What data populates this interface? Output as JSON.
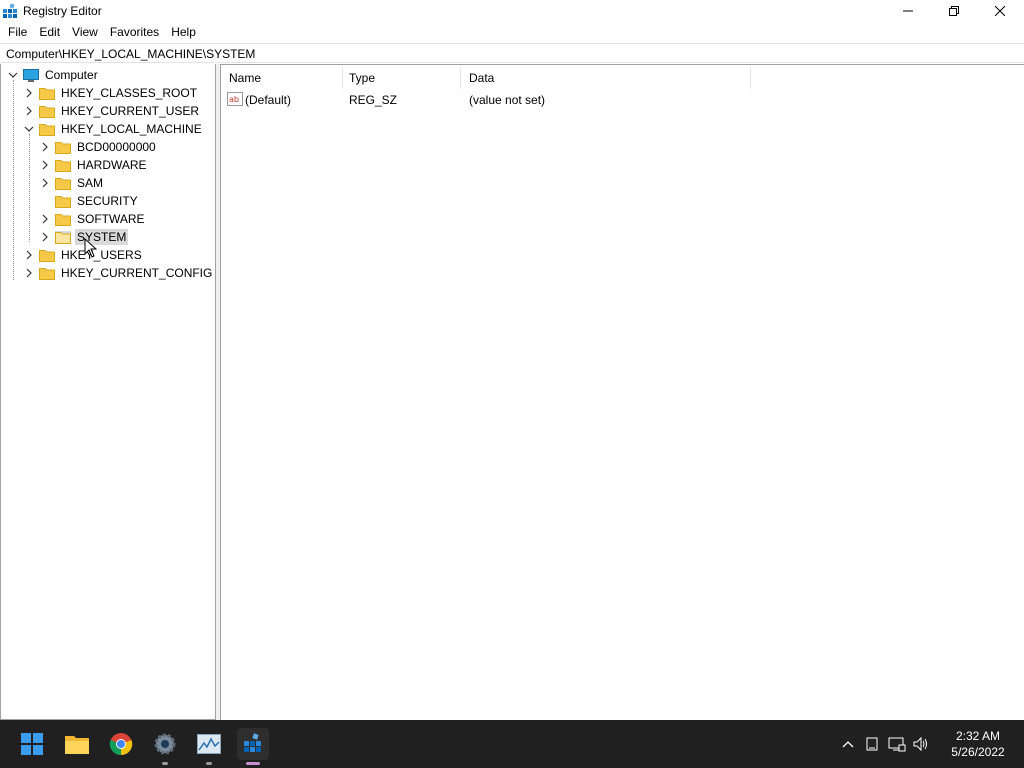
{
  "window": {
    "title": "Registry Editor"
  },
  "menu": {
    "items": [
      "File",
      "Edit",
      "View",
      "Favorites",
      "Help"
    ]
  },
  "address": {
    "path": "Computer\\HKEY_LOCAL_MACHINE\\SYSTEM"
  },
  "tree": {
    "root": "Computer",
    "hives": [
      "HKEY_CLASSES_ROOT",
      "HKEY_CURRENT_USER",
      "HKEY_LOCAL_MACHINE",
      "HKEY_USERS",
      "HKEY_CURRENT_CONFIG"
    ],
    "hklm_children": [
      "BCD00000000",
      "HARDWARE",
      "SAM",
      "SECURITY",
      "SOFTWARE",
      "SYSTEM"
    ],
    "selected": "SYSTEM"
  },
  "list": {
    "columns": [
      "Name",
      "Type",
      "Data"
    ],
    "rows": [
      {
        "name": "(Default)",
        "type": "REG_SZ",
        "data": "(value not set)"
      }
    ]
  },
  "taskbar": {
    "apps": [
      "start-icon",
      "file-explorer-icon",
      "chrome-icon",
      "settings-icon",
      "resource-monitor-icon",
      "registry-editor-icon"
    ],
    "active_app": "registry-editor-icon",
    "clock_time": "2:32 AM",
    "clock_date": "5/26/2022"
  },
  "colors": {
    "folder": "#f7c948",
    "selection": "#d9d9d9",
    "taskbar": "#202020",
    "accent": "#0078d4"
  }
}
